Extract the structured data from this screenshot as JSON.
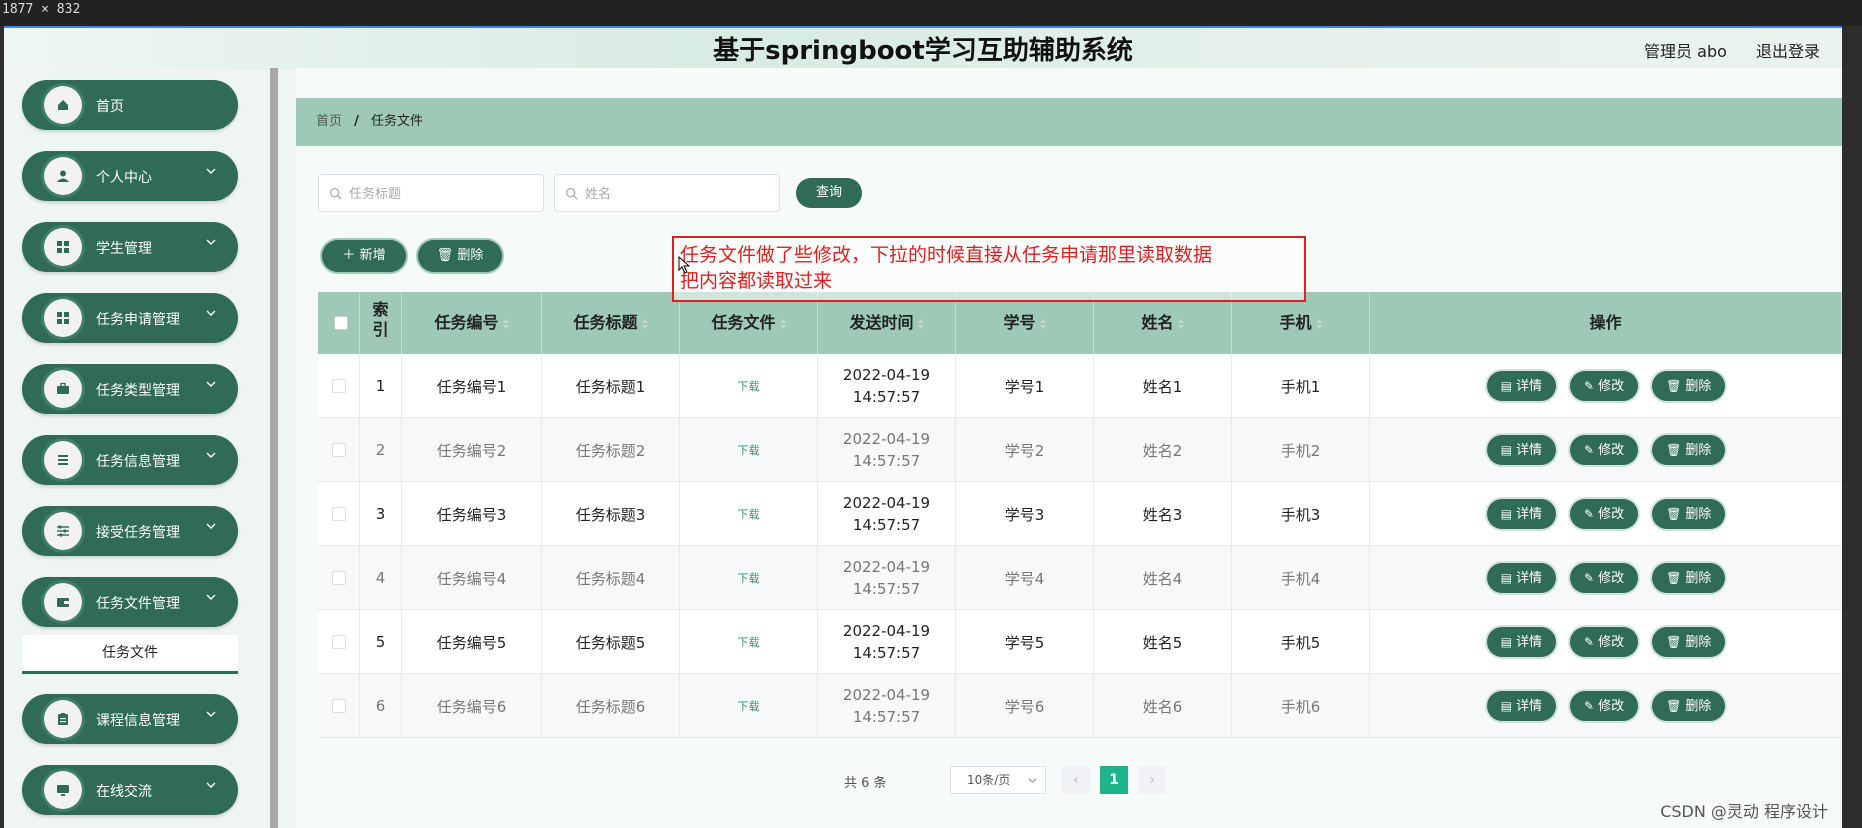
{
  "screen_size_label": "1877 × 832",
  "header": {
    "title": "基于springboot学习互助辅助系统",
    "admin": "管理员 abo",
    "logout": "退出登录"
  },
  "sidebar": {
    "items": [
      {
        "label": "首页",
        "icon": "home-icon"
      },
      {
        "label": "个人中心",
        "icon": "user-icon"
      },
      {
        "label": "学生管理",
        "icon": "grid-icon"
      },
      {
        "label": "任务申请管理",
        "icon": "grid-icon"
      },
      {
        "label": "任务类型管理",
        "icon": "briefcase-icon"
      },
      {
        "label": "任务信息管理",
        "icon": "list-icon"
      },
      {
        "label": "接受任务管理",
        "icon": "sliders-icon"
      },
      {
        "label": "任务文件管理",
        "icon": "wallet-icon"
      },
      {
        "label": "课程信息管理",
        "icon": "clipboard-icon"
      },
      {
        "label": "在线交流",
        "icon": "monitor-icon"
      }
    ],
    "sub_item": "任务文件"
  },
  "breadcrumb": {
    "home": "首页",
    "separator": "/",
    "current": "任务文件"
  },
  "search": {
    "title_placeholder": "任务标题",
    "name_placeholder": "姓名",
    "query_button": "查询"
  },
  "actions": {
    "add": "新增",
    "delete": "删除"
  },
  "annotation": {
    "line1": "任务文件做了些修改，下拉的时候直接从任务申请那里读取数据",
    "line2": "把内容都读取过来"
  },
  "table": {
    "headers": {
      "index": "索引",
      "task_no": "任务编号",
      "task_title": "任务标题",
      "task_file": "任务文件",
      "send_time": "发送时间",
      "student_no": "学号",
      "name": "姓名",
      "phone": "手机",
      "ops": "操作"
    },
    "rows": [
      {
        "idx": "1",
        "no": "任务编号1",
        "title": "任务标题1",
        "file": "下载",
        "time": "2022-04-19 14:57:57",
        "sno": "学号1",
        "name": "姓名1",
        "phone": "手机1"
      },
      {
        "idx": "2",
        "no": "任务编号2",
        "title": "任务标题2",
        "file": "下载",
        "time": "2022-04-19 14:57:57",
        "sno": "学号2",
        "name": "姓名2",
        "phone": "手机2"
      },
      {
        "idx": "3",
        "no": "任务编号3",
        "title": "任务标题3",
        "file": "下载",
        "time": "2022-04-19 14:57:57",
        "sno": "学号3",
        "name": "姓名3",
        "phone": "手机3"
      },
      {
        "idx": "4",
        "no": "任务编号4",
        "title": "任务标题4",
        "file": "下载",
        "time": "2022-04-19 14:57:57",
        "sno": "学号4",
        "name": "姓名4",
        "phone": "手机4"
      },
      {
        "idx": "5",
        "no": "任务编号5",
        "title": "任务标题5",
        "file": "下载",
        "time": "2022-04-19 14:57:57",
        "sno": "学号5",
        "name": "姓名5",
        "phone": "手机5"
      },
      {
        "idx": "6",
        "no": "任务编号6",
        "title": "任务标题6",
        "file": "下载",
        "time": "2022-04-19 14:57:57",
        "sno": "学号6",
        "name": "姓名6",
        "phone": "手机6"
      }
    ],
    "op_labels": {
      "detail": "详情",
      "edit": "修改",
      "delete": "删除"
    }
  },
  "pagination": {
    "total": "共 6 条",
    "page_size": "10条/页",
    "current_page": "1",
    "prev": "‹",
    "next": "›"
  },
  "watermark": "CSDN @灵动 程序设计",
  "colors": {
    "primary": "#2f6b56",
    "header_row": "#9ec9b6",
    "pager_active": "#1fb38a",
    "annotation": "#e02020"
  }
}
